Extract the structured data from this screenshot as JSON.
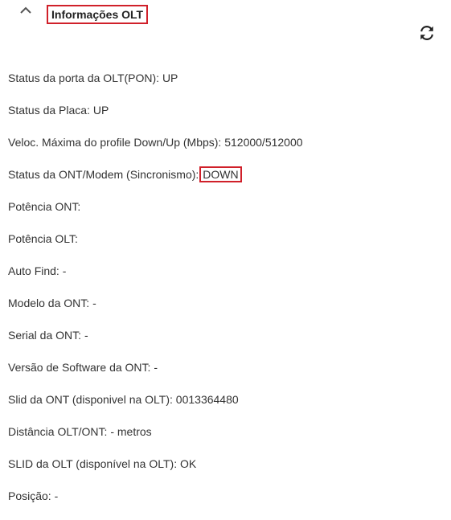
{
  "panel": {
    "title": "Informações OLT",
    "collapse_icon": "chevron-up-icon",
    "refresh_icon": "refresh-icon",
    "highlight_color": "#d0202a"
  },
  "rows": [
    {
      "label": "Status da porta da OLT(PON):",
      "value": "UP"
    },
    {
      "label": "Status da Placa:",
      "value": "UP"
    },
    {
      "label": "Veloc. Máxima do profile Down/Up (Mbps):",
      "value": "512000/512000"
    },
    {
      "label": "Status da ONT/Modem (Sincronismo):",
      "value": "DOWN"
    },
    {
      "label": "Potência ONT:",
      "value": ""
    },
    {
      "label": "Potência OLT:",
      "value": ""
    },
    {
      "label": "Auto Find:",
      "value": "-"
    },
    {
      "label": "Modelo da ONT:",
      "value": "-"
    },
    {
      "label": "Serial da ONT:",
      "value": "-"
    },
    {
      "label": "Versão de Software da ONT:",
      "value": "-"
    },
    {
      "label": "Slid da ONT (disponivel na OLT):",
      "value": "0013364480"
    },
    {
      "label": "Distância OLT/ONT:",
      "value": "- metros"
    },
    {
      "label": "SLID da OLT (disponível na OLT):",
      "value": "OK"
    },
    {
      "label": "Posição:",
      "value": "-"
    }
  ]
}
